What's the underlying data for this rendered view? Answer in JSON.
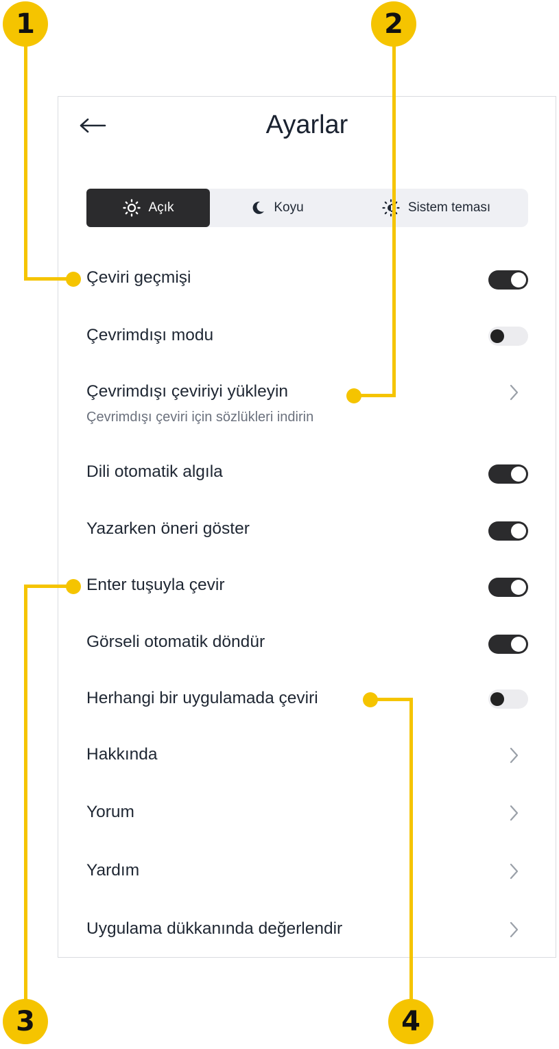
{
  "header": {
    "title": "Ayarlar",
    "back_icon": "arrow-left-icon"
  },
  "theme": {
    "options": [
      {
        "label": "Açık",
        "icon": "sun-icon",
        "selected": true
      },
      {
        "label": "Koyu",
        "icon": "moon-icon",
        "selected": false
      },
      {
        "label": "Sistem teması",
        "icon": "system-theme-icon",
        "selected": false
      }
    ]
  },
  "settings": [
    {
      "label": "Çeviri geçmişi",
      "control": "toggle",
      "on": true
    },
    {
      "label": "Çevrimdışı modu",
      "control": "toggle",
      "on": false
    },
    {
      "label": "Çevrimdışı çeviriyi yükleyin",
      "sub": "Çevrimdışı çeviri için sözlükleri indirin",
      "control": "chevron"
    },
    {
      "label": "Dili otomatik algıla",
      "control": "toggle",
      "on": true
    },
    {
      "label": "Yazarken öneri göster",
      "control": "toggle",
      "on": true
    },
    {
      "label": "Enter tuşuyla çevir",
      "control": "toggle",
      "on": true
    },
    {
      "label": "Görseli otomatik döndür",
      "control": "toggle",
      "on": true
    },
    {
      "label": "Herhangi bir uygulamada çeviri",
      "control": "toggle",
      "on": false
    },
    {
      "label": "Hakkında",
      "control": "chevron"
    },
    {
      "label": "Yorum",
      "control": "chevron"
    },
    {
      "label": "Yardım",
      "control": "chevron"
    },
    {
      "label": "Uygulama dükkanında değerlendir",
      "control": "chevron"
    }
  ],
  "callouts": [
    "1",
    "2",
    "3",
    "4"
  ],
  "colors": {
    "accent": "#f5c400",
    "dark": "#2b2b2d",
    "segment_bg": "#eff0f4"
  }
}
